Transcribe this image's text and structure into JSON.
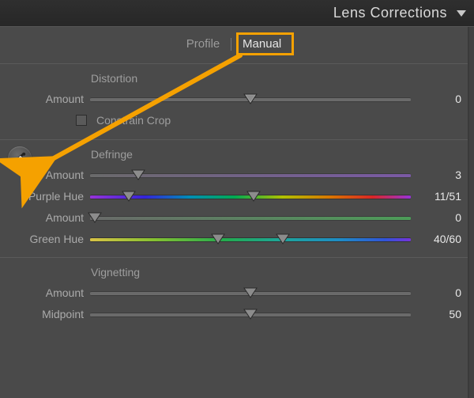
{
  "header": {
    "title": "Lens Corrections"
  },
  "tabs": {
    "profile": "Profile",
    "manual": "Manual",
    "active": "manual"
  },
  "distortion": {
    "heading": "Distortion",
    "amount_label": "Amount",
    "amount_value": "0",
    "constrain_label": "Constrain Crop",
    "constrain_checked": false
  },
  "defringe": {
    "heading": "Defringe",
    "amount1_label": "Amount",
    "amount1_value": "3",
    "purplehue_label": "Purple Hue",
    "purplehue_value": "11/51",
    "amount2_label": "Amount",
    "amount2_value": "0",
    "greenhue_label": "Green Hue",
    "greenhue_value": "40/60"
  },
  "vignetting": {
    "heading": "Vignetting",
    "amount_label": "Amount",
    "amount_value": "0",
    "midpoint_label": "Midpoint",
    "midpoint_value": "50"
  },
  "icons": {
    "eyedropper": "eyedropper-icon",
    "disclosure": "triangle-down-icon"
  },
  "colors": {
    "annotation": "#f5a100"
  }
}
